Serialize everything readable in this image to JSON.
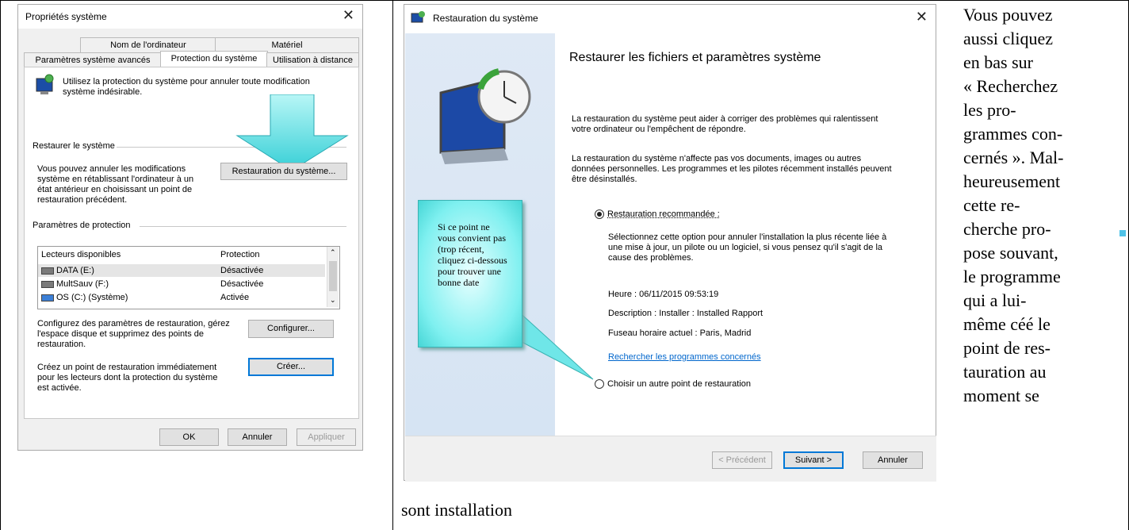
{
  "left_dialog": {
    "title": "Propriétés système",
    "tabs": [
      "Nom de l'ordinateur",
      "Matériel",
      "Paramètres système avancés",
      "Protection du système",
      "Utilisation à distance"
    ],
    "intro": "Utilisez la protection du système pour annuler toute modification système indésirable.",
    "restore_group": "Restaurer le système",
    "restore_text": "Vous pouvez annuler les modifications système en rétablissant l'ordinateur à un état antérieur en choisissant un point de restauration précédent.",
    "restore_button": "Restauration du système...",
    "protection_group": "Paramètres de protection",
    "list_headers": [
      "Lecteurs disponibles",
      "Protection"
    ],
    "drives": [
      {
        "name": "DATA (E:)",
        "status": "Désactivée"
      },
      {
        "name": "MultSauv (F:)",
        "status": "Désactivée"
      },
      {
        "name": "OS (C:) (Système)",
        "status": "Activée"
      }
    ],
    "configure_text": "Configurez des paramètres de restauration, gérez l'espace disque et supprimez des points de restauration.",
    "configure_button": "Configurer...",
    "create_text": "Créez un point de restauration immédiatement pour les lecteurs dont la protection du système est activée.",
    "create_button": "Créer...",
    "ok": "OK",
    "cancel": "Annuler",
    "apply": "Appliquer"
  },
  "right_dialog": {
    "title": "Restauration du système",
    "heading": "Restaurer les fichiers et paramètres système",
    "para1": "La restauration du système peut aider à corriger des problèmes qui ralentissent votre ordinateur ou l'empêchent de répondre.",
    "para2": "La restauration du système n'affecte pas vos documents, images ou autres données personnelles. Les programmes et les pilotes récemment installés peuvent être désinstallés.",
    "option1": "Restauration recommandée :",
    "option1_desc": "Sélectionnez cette option pour annuler l'installation la plus récente liée à une mise à jour, un pilote ou un logiciel, si vous pensez qu'il s'agit de la cause des problèmes.",
    "time": "Heure : 06/11/2015 09:53:19",
    "description": "Description : Installer : Installed Rapport",
    "timezone": "Fuseau horaire actuel : Paris, Madrid",
    "link": "Rechercher les programmes concernés",
    "option2": "Choisir un autre point de restauration",
    "prev": "< Précédent",
    "next": "Suivant >",
    "cancel": "Annuler"
  },
  "callout": "Si ce point ne vous convient pas (trop récent, cliquez ci-dessous pour trouver une bonne date",
  "doc_text": [
    "Vous pouvez",
    "aussi cliquez",
    "en bas sur",
    "« Recherchez",
    "les pro-",
    "grammes con-",
    "cernés ». Mal-",
    "heureusement",
    "cette re-",
    "cherche pro-",
    "pose souvant,",
    "le programme",
    "qui a lui-",
    "même céé le",
    "point de res-",
    "tauration au",
    "moment se"
  ],
  "doc_bottom": "sont installation"
}
